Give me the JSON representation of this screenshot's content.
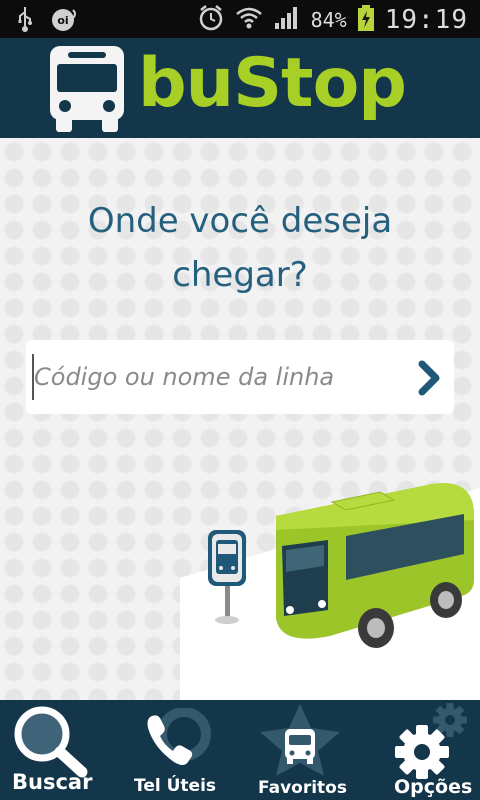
{
  "status_bar": {
    "battery": "84%",
    "time": "19:19"
  },
  "header": {
    "title": "buStop"
  },
  "main": {
    "question": "Onde você deseja chegar?",
    "search": {
      "placeholder": "Código ou nome da linha",
      "value": ""
    }
  },
  "bottom_nav": {
    "items": [
      {
        "label": "Buscar",
        "icon": "search-icon"
      },
      {
        "label": "Tel Úteis",
        "icon": "phone-icon"
      },
      {
        "label": "Favoritos",
        "icon": "bus-star-icon"
      },
      {
        "label": "Opções",
        "icon": "gear-icon"
      }
    ]
  },
  "colors": {
    "brand": "#13364a",
    "accent": "#a7cf26",
    "text": "#26607f"
  }
}
